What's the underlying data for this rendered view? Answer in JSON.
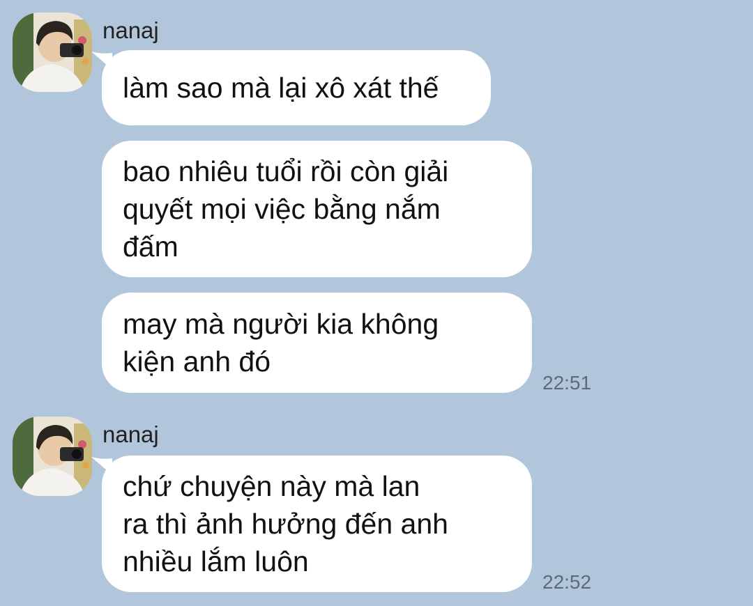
{
  "chat": {
    "background_color": "#b1c6da",
    "bubble_color": "#ffffff",
    "groups": [
      {
        "sender": "nanaj",
        "avatar": "profile-photo-person-with-camera",
        "messages": [
          {
            "text": "làm sao mà lại xô xát thế"
          },
          {
            "text": "bao nhiêu tuổi rồi còn giải\nquyết mọi việc bằng nắm\nđấm"
          },
          {
            "text": "may mà người kia không\nkiện anh đó"
          }
        ],
        "time": "22:51"
      },
      {
        "sender": "nanaj",
        "avatar": "profile-photo-person-with-camera",
        "messages": [
          {
            "text": "chứ chuyện này mà lan\nra thì ảnh hưởng đến anh\nnhiều lắm luôn"
          }
        ],
        "time": "22:52"
      }
    ]
  }
}
